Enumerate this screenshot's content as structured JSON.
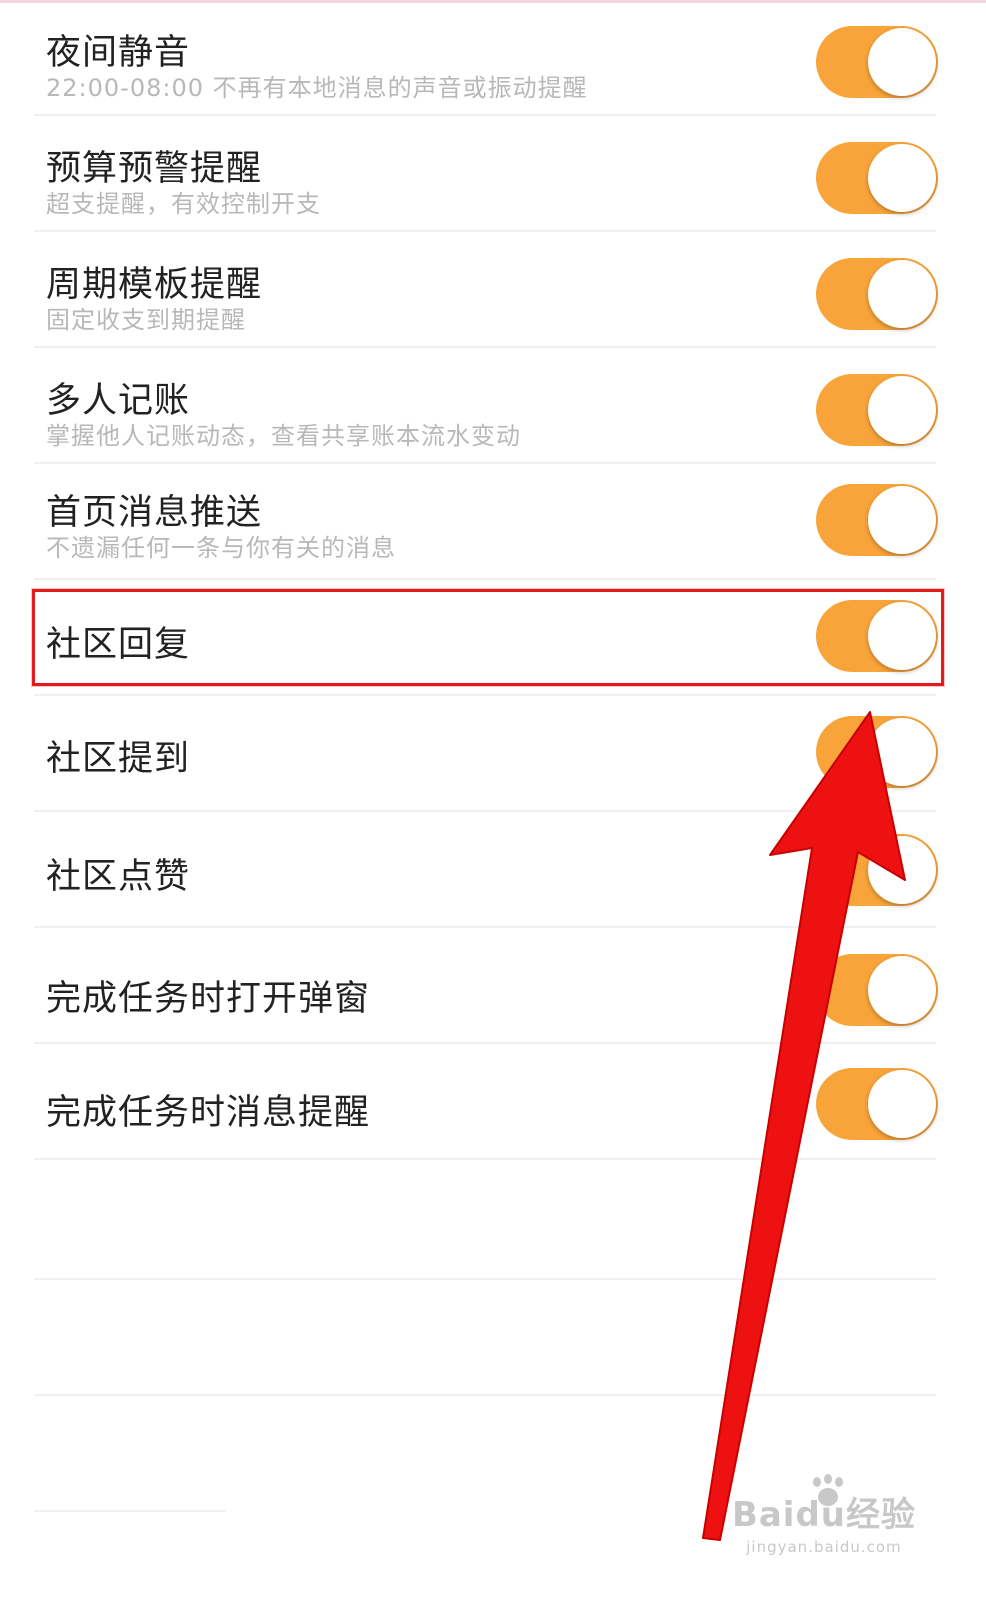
{
  "settings": {
    "rows": [
      {
        "title": "夜间静音",
        "subtitle": "22:00-08:00 不再有本地消息的声音或振动提醒",
        "enabled": true
      },
      {
        "title": "预算预警提醒",
        "subtitle": "超支提醒，有效控制开支",
        "enabled": true
      },
      {
        "title": "周期模板提醒",
        "subtitle": "固定收支到期提醒",
        "enabled": true
      },
      {
        "title": "多人记账",
        "subtitle": "掌握他人记账动态，查看共享账本流水变动",
        "enabled": true
      },
      {
        "title": "首页消息推送",
        "subtitle": "不遗漏任何一条与你有关的消息",
        "enabled": true
      },
      {
        "title": "社区回复",
        "subtitle": "",
        "enabled": true
      },
      {
        "title": "社区提到",
        "subtitle": "",
        "enabled": true
      },
      {
        "title": "社区点赞",
        "subtitle": "",
        "enabled": true
      },
      {
        "title": "完成任务时打开弹窗",
        "subtitle": "",
        "enabled": true
      },
      {
        "title": "完成任务时消息提醒",
        "subtitle": "",
        "enabled": true
      }
    ],
    "highlighted_row": "社区回复"
  },
  "colors": {
    "toggle_on": "#f9a43a",
    "highlight_border": "#e21b1b",
    "arrow": "#ee1111"
  },
  "watermark": {
    "main": "Baidu经验",
    "sub": "jingyan.baidu.com"
  }
}
